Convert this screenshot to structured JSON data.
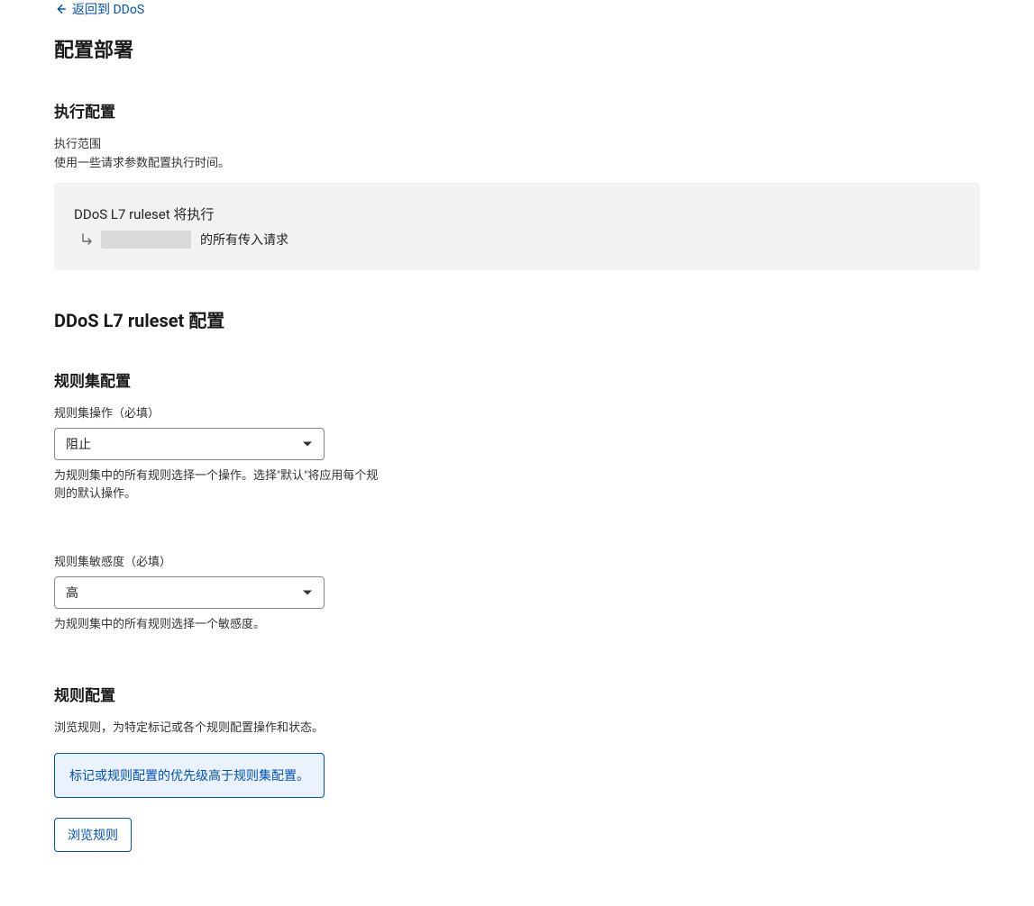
{
  "back": {
    "label": "返回到 DDoS"
  },
  "page_title": "配置部署",
  "exec_section": {
    "title": "执行配置",
    "scope_label": "执行范围",
    "scope_desc": "使用一些请求参数配置执行时间。",
    "panel": {
      "ruleset_name": "DDoS L7 ruleset",
      "will_execute_suffix": " 将执行",
      "all_incoming_suffix": " 的所有传入请求"
    }
  },
  "config_section": {
    "title": "DDoS L7 ruleset 配置"
  },
  "ruleset_config": {
    "title": "规则集配置",
    "action_label": "规则集操作（必填）",
    "action_value": "阻止",
    "action_help": "为规则集中的所有规则选择一个操作。选择\"默认\"将应用每个规则的默认操作。",
    "sensitivity_label": "规则集敏感度（必填）",
    "sensitivity_value": "高",
    "sensitivity_help": "为规则集中的所有规则选择一个敏感度。"
  },
  "rule_config": {
    "title": "规则配置",
    "desc": "浏览规则，为特定标记或各个规则配置操作和状态。",
    "notice": "标记或规则配置的优先级高于规则集配置。",
    "browse_button": "浏览规则"
  }
}
